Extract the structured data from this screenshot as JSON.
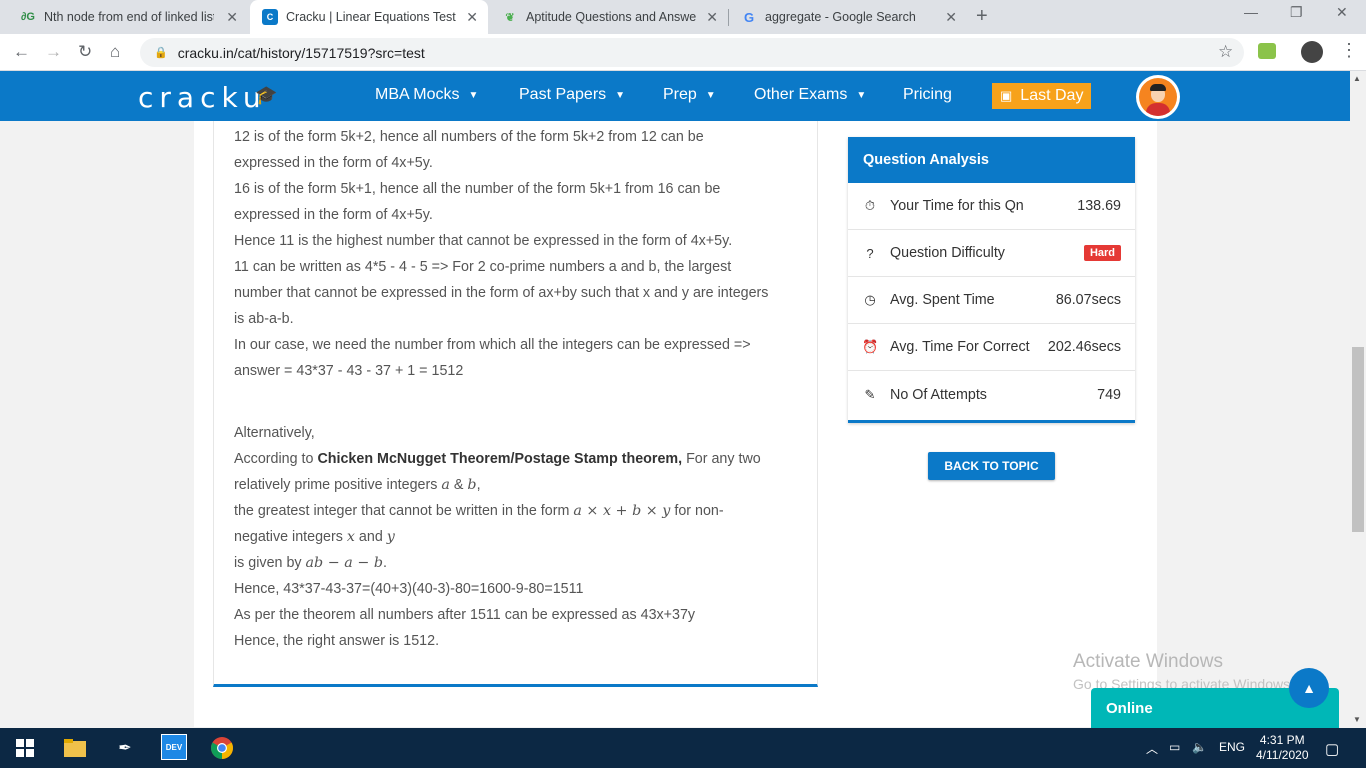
{
  "browser": {
    "tabs": [
      {
        "title": "Nth node from end of linked list |",
        "icon": "geeksforgeeks-icon"
      },
      {
        "title": "Cracku | Linear Equations Test So",
        "icon": "cracku-icon"
      },
      {
        "title": "Aptitude Questions and Answers",
        "icon": "indiabix-icon"
      },
      {
        "title": "aggregate - Google Search",
        "icon": "google-icon"
      }
    ],
    "url": "cracku.in/cat/history/15717519?src=test"
  },
  "header": {
    "logo": "cracku",
    "nav": [
      "MBA Mocks",
      "Past Papers",
      "Prep",
      "Other Exams"
    ],
    "pricing": "Pricing",
    "last_day": "Last Day"
  },
  "solution": {
    "lines": [
      "12 is of the form 5k+2, hence all numbers of the form 5k+2 from 12 can be",
      "expressed in the form of 4x+5y.",
      "16 is of the form 5k+1, hence all the number of the form 5k+1 from 16 can be",
      "expressed in the form of 4x+5y.",
      "Hence 11 is the highest number that cannot be expressed in the form of 4x+5y.",
      "11 can be written as 4*5 - 4 - 5 => For 2 co-prime numbers a and b, the largest",
      "number that cannot be expressed in the form of ax+by such that x and y are integers",
      "is ab-a-b.",
      "In our case, we need the number from which all the integers can be expressed =>",
      "answer = 43*37 - 43 - 37 + 1 = 1512"
    ],
    "alt_intro": "Alternatively,",
    "according_prefix": "According to ",
    "theorem_name": "Chicken McNugget Theorem/Postage Stamp theorem,",
    "according_suffix": " For any two",
    "relatively_prime": "relatively prime positive integers ",
    "math_a": "a",
    "amp": " & ",
    "math_b": "b",
    "comma": ",",
    "greatest_prefix": "the greatest integer that cannot be written in the form ",
    "math_form": "a × x + b × y",
    "greatest_suffix": " for non-",
    "negative_prefix": "negative integers ",
    "math_x": "x",
    "and_word": " and ",
    "math_y": "y",
    "given_by_prefix": "is given by ",
    "math_result": "ab − a − b",
    "period": ".",
    "final_lines": [
      "Hence, 43*37-43-37=(40+3)(40-3)-80=1600-9-80=1511",
      "As per the theorem all numbers after 1511 can be expressed as 43x+37y",
      "Hence, the right answer is 1512."
    ]
  },
  "analysis": {
    "title": "Question Analysis",
    "rows": [
      {
        "label": "Your Time for this Qn",
        "value": "138.69",
        "icon": "stopwatch-icon"
      },
      {
        "label": "Question Difficulty",
        "value": "Hard",
        "icon": "question-circle-icon"
      },
      {
        "label": "Avg. Spent Time",
        "value": "86.07secs",
        "icon": "clock-icon"
      },
      {
        "label": "Avg. Time For Correct",
        "value": "202.46secs",
        "icon": "alarm-icon"
      },
      {
        "label": "No Of Attempts",
        "value": "749",
        "icon": "edit-icon"
      }
    ],
    "back_button": "BACK TO TOPIC"
  },
  "watermark": {
    "line1": "Activate Windows",
    "line2": "Go to Settings to activate Windows."
  },
  "chat": {
    "label": "Online"
  },
  "taskbar": {
    "lang": "ENG",
    "time": "4:31 PM",
    "date": "4/11/2020"
  },
  "colors": {
    "brand_blue": "#0b79c8",
    "last_day_orange": "#f7a21b",
    "hard_red": "#e53935",
    "online_teal": "#00b7b7"
  }
}
